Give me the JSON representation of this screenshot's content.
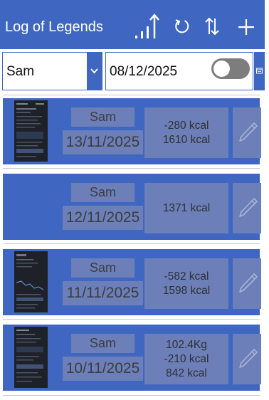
{
  "app": {
    "title": "Log of Legends"
  },
  "filters": {
    "user_value": "Sam",
    "date_value": "08/12/2025",
    "toggle_on": false
  },
  "entries": [
    {
      "name": "Sam",
      "date": "13/11/2025",
      "lines": [
        "-280 kcal",
        "1610 kcal"
      ],
      "has_thumbnail": true
    },
    {
      "name": "Sam",
      "date": "12/11/2025",
      "lines": [
        "1371 kcal"
      ],
      "has_thumbnail": false
    },
    {
      "name": "Sam",
      "date": "11/11/2025",
      "lines": [
        "-582 kcal",
        "1598 kcal"
      ],
      "has_thumbnail": true
    },
    {
      "name": "Sam",
      "date": "10/11/2025",
      "lines": [
        "102.4Kg",
        "-210 kcal",
        "842 kcal"
      ],
      "has_thumbnail": true
    }
  ],
  "colors": {
    "primary": "#3f67c1",
    "chip": "#6c7fb8",
    "toggle_off": "#7d7d7d"
  },
  "icons": [
    "stats-icon",
    "refresh-icon",
    "sort-icon",
    "add-icon",
    "chevron-down-icon",
    "calendar-icon",
    "pencil-icon"
  ]
}
